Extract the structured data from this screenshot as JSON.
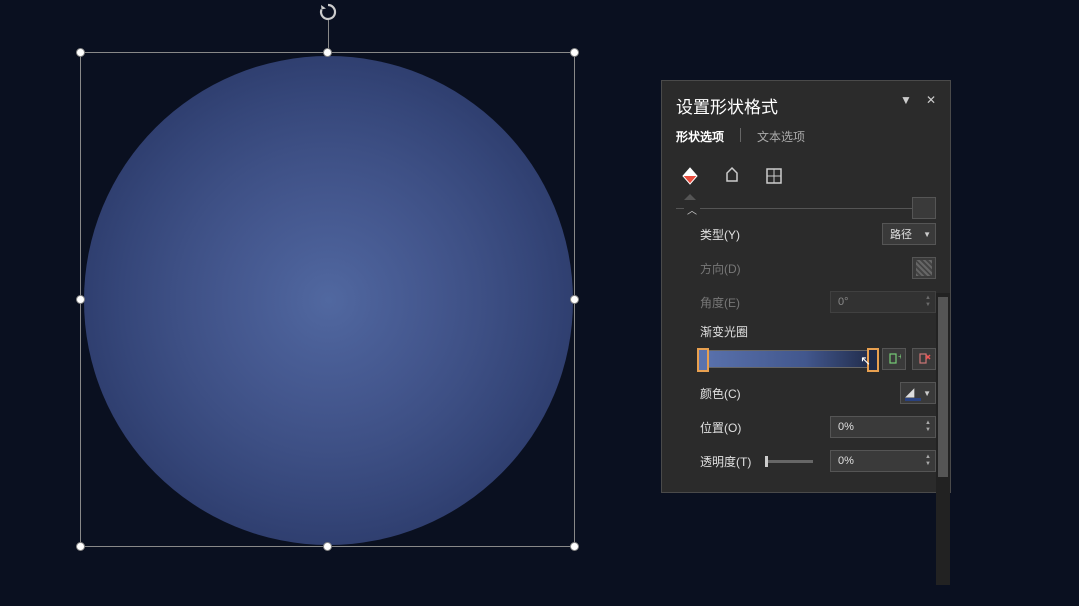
{
  "panel": {
    "title": "设置形状格式",
    "tabs": {
      "shape_options": "形状选项",
      "text_options": "文本选项"
    },
    "fields": {
      "type": {
        "label": "类型(Y)",
        "value": "路径"
      },
      "direction": {
        "label": "方向(D)"
      },
      "angle": {
        "label": "角度(E)",
        "value": "0°"
      },
      "gradient_stops": {
        "label": "渐变光圈"
      },
      "color": {
        "label": "颜色(C)"
      },
      "position": {
        "label": "位置(O)",
        "value": "0%"
      },
      "transparency": {
        "label": "透明度(T)",
        "value": "0%"
      }
    },
    "icons": {
      "fill": "fill-line-icon",
      "effects": "effects-icon",
      "size": "size-properties-icon",
      "add_stop": "add-gradient-stop",
      "remove_stop": "remove-gradient-stop"
    }
  },
  "shape": {
    "gradient_colors": [
      "#5a72ad",
      "#1f2a47"
    ]
  }
}
